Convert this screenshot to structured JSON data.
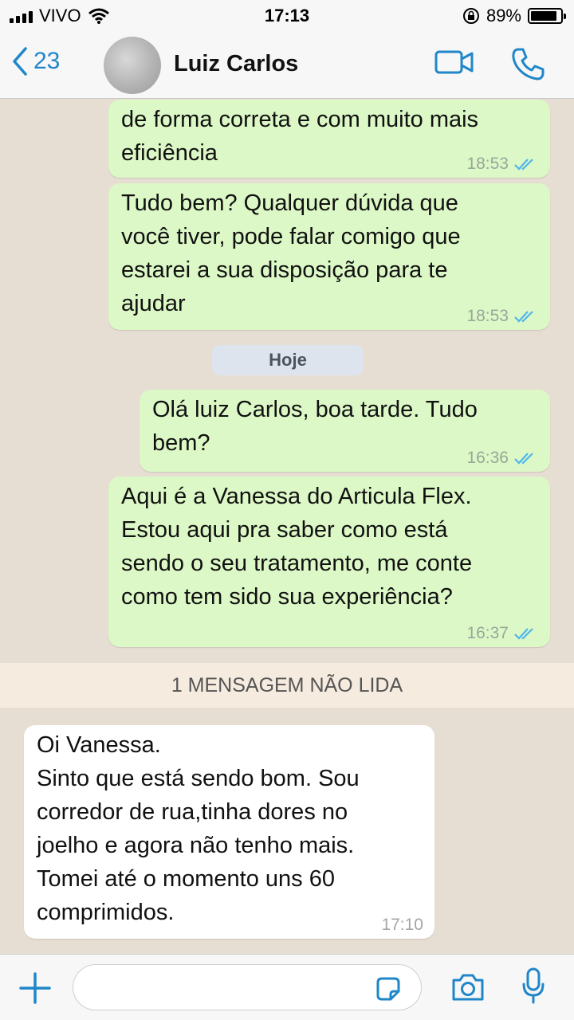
{
  "status_bar": {
    "carrier": "VIVO",
    "time": "17:13",
    "battery": "89%",
    "battery_level": 0.89,
    "icons": [
      "signal-icon",
      "wifi-icon",
      "rotation-lock-icon",
      "battery-icon"
    ]
  },
  "header": {
    "back_count": "23",
    "contact_name": "Luiz Carlos",
    "icons": [
      "chevron-left-icon",
      "video-camera-icon",
      "phone-icon"
    ]
  },
  "messages": [
    {
      "direction": "out",
      "text": "de forma correta e com muito mais\neficiência",
      "time": "18:53",
      "read": true
    },
    {
      "direction": "out",
      "text": "Tudo bem? Qualquer dúvida que\nvocê tiver, pode falar comigo que\nestarei a sua disposição para te\najudar",
      "time": "18:53",
      "read": true
    },
    {
      "direction": "out",
      "text": "Olá luiz Carlos, boa tarde. Tudo\nbem?",
      "time": "16:36",
      "read": true
    },
    {
      "direction": "out",
      "text": "Aqui é a Vanessa do Articula Flex.\nEstou aqui pra saber como está\nsendo o seu tratamento, me conte\ncomo tem sido sua experiência?",
      "time": "16:37",
      "read": true
    },
    {
      "direction": "in",
      "text": "Oi Vanessa.\nSinto que está sendo bom. Sou\ncorredor de rua,tinha dores no\njoelho e agora não tenho mais.\nTomei até o momento uns 60\ncomprimidos.",
      "time": "17:10"
    }
  ],
  "date_divider": "Hoje",
  "unread_banner": "1 MENSAGEM NÃO LIDA",
  "input_bar": {
    "message_value": "",
    "icons": [
      "plus-icon",
      "sticker-icon",
      "camera-icon",
      "microphone-icon"
    ]
  },
  "colors": {
    "accent": "#1f87c9",
    "outgoing_bubble": "#dcf8c6",
    "incoming_bubble": "#ffffff",
    "chat_background": "#e7ded3",
    "read_ticks": "#4fb6ec"
  }
}
